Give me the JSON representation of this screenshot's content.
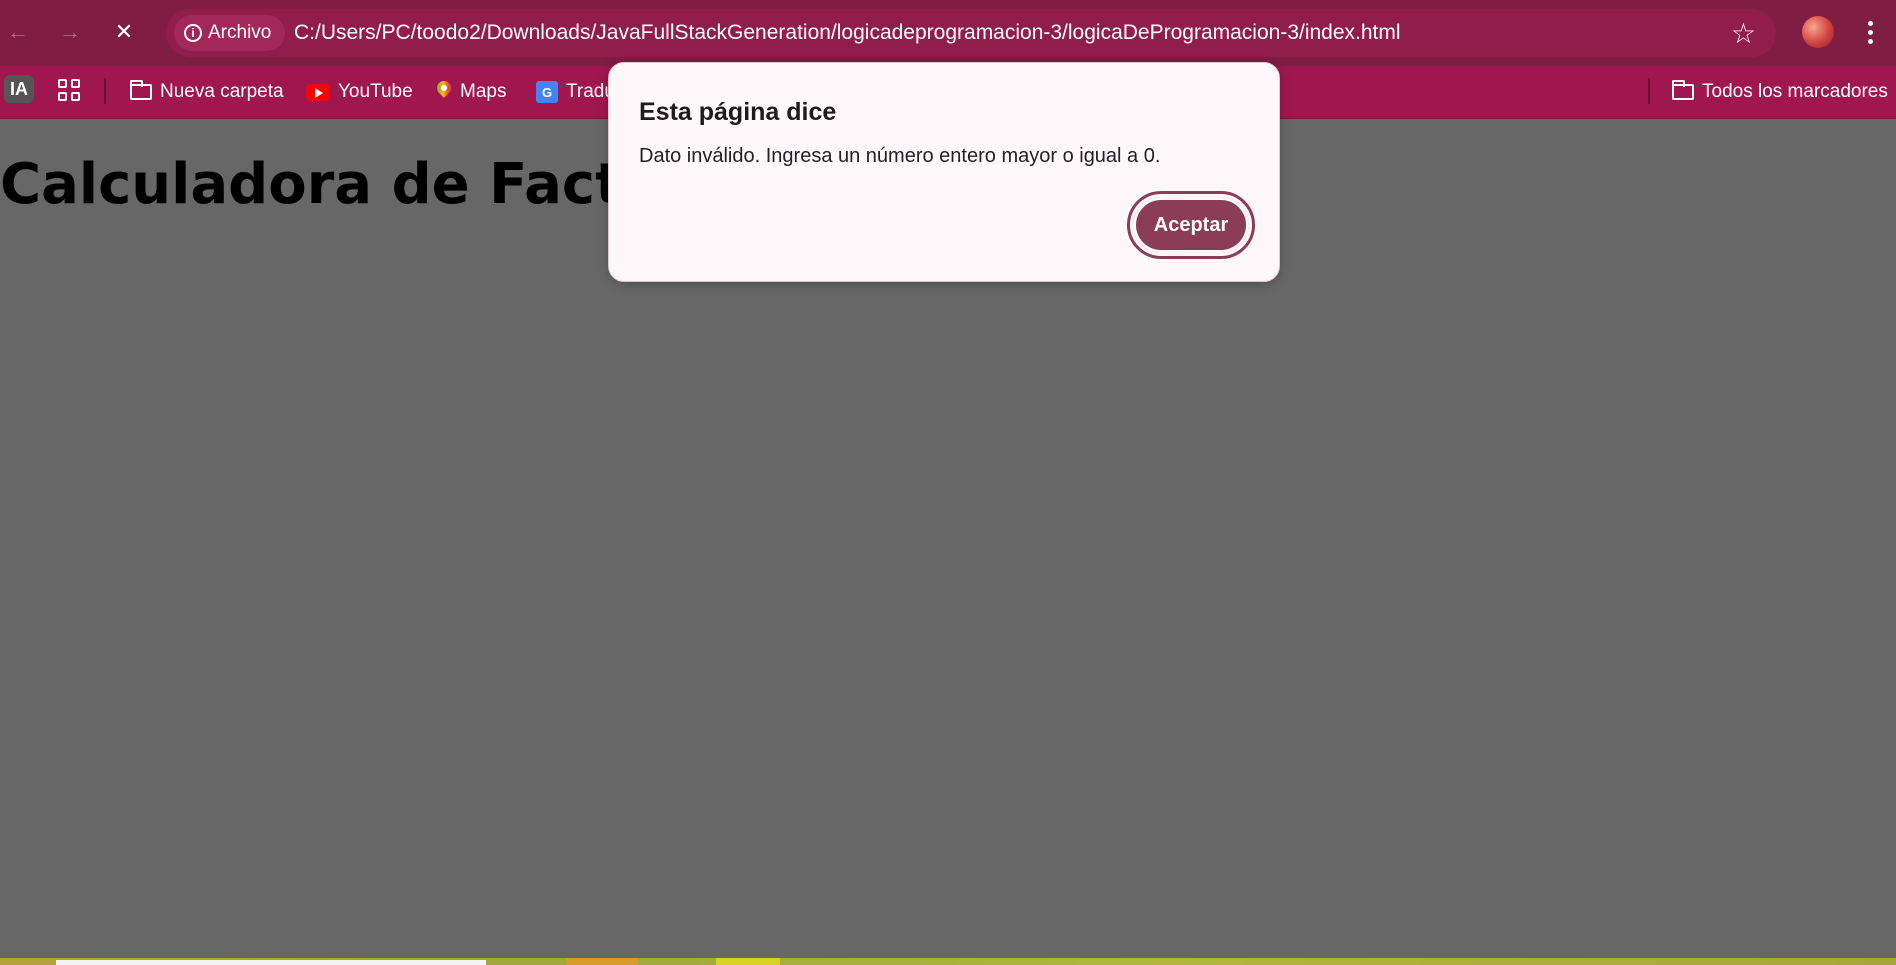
{
  "browser": {
    "nav": {
      "back_icon": "←",
      "forward_icon": "→",
      "stop_icon": "✕"
    },
    "site_chip": {
      "label": "Archivo",
      "icon": "info-icon"
    },
    "url": "C:/Users/PC/toodo2/Downloads/JavaFullStackGeneration/logicadeprogramacion-3/logicaDeProgramacion-3/index.html",
    "star_icon": "☆",
    "colors": {
      "toolbar": "#7f1d43",
      "bookmarks_bar": "#a0174f",
      "accent": "#8b3c57"
    }
  },
  "bookmarks": {
    "ia": "IA",
    "items": [
      {
        "label": "Nueva carpeta",
        "icon": "folder-icon"
      },
      {
        "label": "YouTube",
        "icon": "youtube-icon"
      },
      {
        "label": "Maps",
        "icon": "maps-icon"
      },
      {
        "label": "Tradu",
        "icon": "translate-icon"
      }
    ],
    "all_bookmarks": "Todos los marcadores"
  },
  "page": {
    "title": "Calculadora de Factori"
  },
  "dialog": {
    "title": "Esta página dice",
    "message": "Dato inválido. Ingresa un número entero mayor o igual a 0.",
    "ok_label": "Aceptar"
  }
}
